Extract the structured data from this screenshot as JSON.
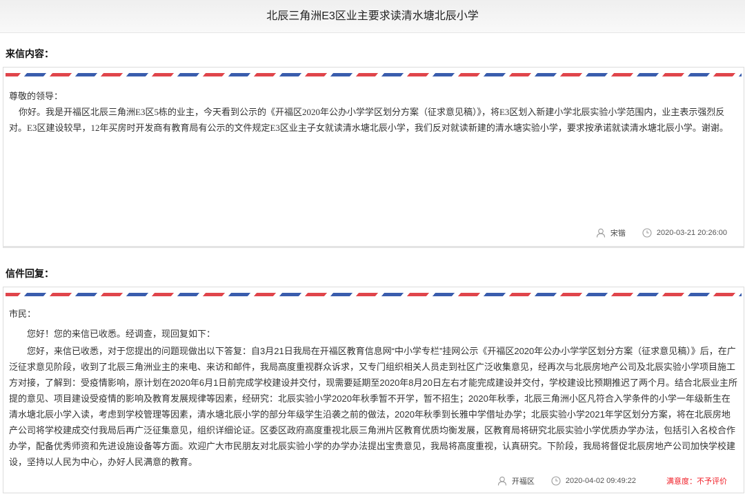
{
  "page": {
    "title": "北辰三角洲E3区业主要求读清水塘北辰小学"
  },
  "letter": {
    "section_label": "来信内容：",
    "salutation": "尊敬的领导：",
    "body": "你好。我是开福区北辰三角洲E3区5栋的业主，今天看到公示的《开福区2020年公办小学学区划分方案（征求意见稿）》，将E3区划入新建小学北辰实验小学范围内，业主表示强烈反对。E3区建设较早，12年买房时开发商有教育局有公示的文件规定E3区业主子女就读清水塘北辰小学，我们反对就读新建的清水塘实验小学，要求按承诺就读清水塘北辰小学。谢谢。",
    "author": "宋锴",
    "time": "2020-03-21 20:26:00"
  },
  "reply": {
    "section_label": "信件回复：",
    "salutation": "市民：",
    "greeting": "您好！您的来信已收悉。经调查，现回复如下：",
    "body": "您好，来信已收悉，对于您提出的问题现做出以下答复：自3月21日我局在开福区教育信息网“中小学专栏”挂网公示《开福区2020年公办小学学区划分方案（征求意见稿）》后，在广泛征求意见阶段，收到了北辰三角洲业主的来电、来访和邮件，我局高度重视群众诉求，又专门组织相关人员走到社区广泛收集意见，经再次与北辰房地产公司及北辰实验小学项目施工方对接，了解到：受疫情影响，原计划在2020年6月1日前完成学校建设并交付，现需要延期至2020年8月20日左右才能完成建设并交付，学校建设比预期推迟了两个月。结合北辰业主所提的意见、项目建设受疫情的影响及教育发展规律等因素，经研究：北辰实验小学2020年秋季暂不开学，暂不招生；2020年秋季，北辰三角洲小区凡符合入学条件的小学一年级新生在清水塘北辰小学入读，考虑到学校管理等因素，清水塘北辰小学的部分年级学生沿袭之前的做法，2020年秋季到长雅中学借址办学；北辰实验小学2021年学区划分方案，将在北辰房地产公司将学校建成交付我局后再广泛征集意见，组织详细论证。区委区政府高度重视北辰三角洲片区教育优质均衡发展，区教育局将研究北辰实验小学优质办学办法，包括引入名校合作办学，配备优秀师资和先进设施设备等方面。欢迎广大市民朋友对北辰实验小学的办学办法提出宝贵意见，我局将高度重视，认真研究。下阶段，我局将督促北辰房地产公司加快学校建设，坚持以人民为中心，办好人民满意的教育。",
    "replier": "开福区",
    "time": "2020-04-02 09:49:22",
    "satisfaction": "满意度：不予评价"
  },
  "icons": {
    "person": "person-icon",
    "time": "clock-icon"
  },
  "colors": {
    "stripe_red": "#e0454b",
    "stripe_blue": "#3a5dad",
    "satisfaction": "#f01e27"
  }
}
